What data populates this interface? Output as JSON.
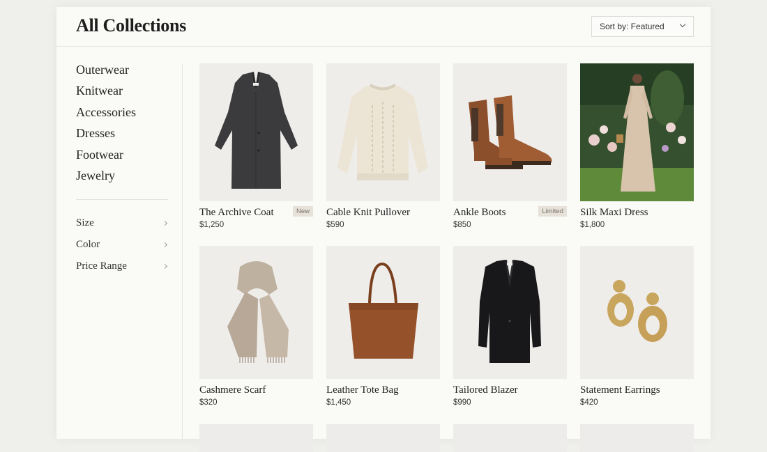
{
  "header": {
    "title": "All Collections",
    "sort_label": "Sort by: Featured"
  },
  "sidebar": {
    "categories": [
      "Outerwear",
      "Knitwear",
      "Accessories",
      "Dresses",
      "Footwear",
      "Jewelry"
    ],
    "filters": [
      "Size",
      "Color",
      "Price Range"
    ]
  },
  "products": [
    {
      "name": "The Archive Coat",
      "price": "$1,250",
      "badge": "New"
    },
    {
      "name": "Cable Knit Pullover",
      "price": "$590"
    },
    {
      "name": "Ankle Boots",
      "price": "$850",
      "badge": "Limited"
    },
    {
      "name": "Silk Maxi Dress",
      "price": "$1,800"
    },
    {
      "name": "Cashmere Scarf",
      "price": "$320"
    },
    {
      "name": "Leather Tote Bag",
      "price": "$1,450"
    },
    {
      "name": "Tailored Blazer",
      "price": "$990"
    },
    {
      "name": "Statement Earrings",
      "price": "$420"
    }
  ],
  "colors": {
    "page": "#efefec",
    "panel": "#fafaf7",
    "badge_bg": "#e6e2da",
    "thumb_bg": "#eeecea"
  }
}
